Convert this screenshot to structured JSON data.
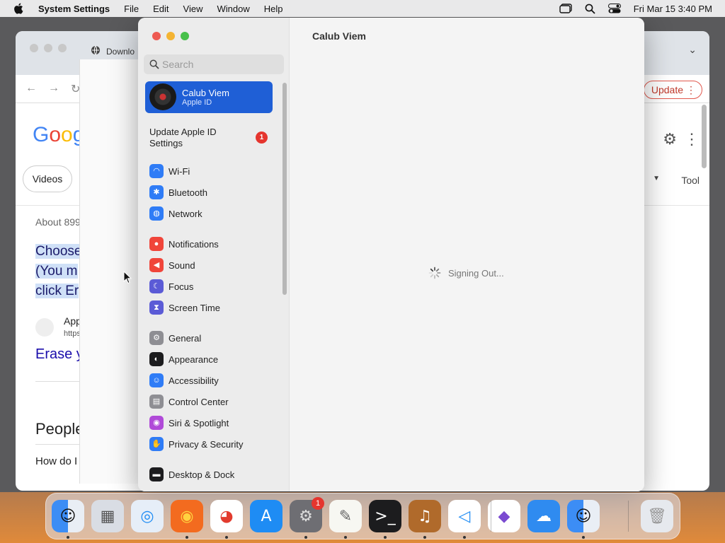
{
  "menubar": {
    "app_name": "System Settings",
    "items": [
      "File",
      "Edit",
      "View",
      "Window",
      "Help"
    ],
    "clock": "Fri Mar 15  3:40 PM"
  },
  "browser": {
    "tab_title": "Downlo",
    "update_label": "Update",
    "google_partial": "Goog",
    "videos_label": "Videos",
    "tools_partial": "Tool",
    "about_partial": "About 899",
    "choose_lines": [
      "Choose",
      "(You m",
      "click Er"
    ],
    "result_title_partial": "App",
    "result_url_partial": "https",
    "erase_partial": "Erase y",
    "people_partial": "People",
    "howdo_partial": "How do I"
  },
  "settings": {
    "search_placeholder": "Search",
    "account": {
      "name": "Calub Viem",
      "sub": "Apple ID"
    },
    "update_apple_id": "Update Apple ID Settings",
    "update_badge": "1",
    "sidebar_items": [
      {
        "label": "Wi-Fi",
        "color": "#2f7cf6"
      },
      {
        "label": "Bluetooth",
        "color": "#2f7cf6"
      },
      {
        "label": "Network",
        "color": "#2f7cf6"
      },
      {
        "label": "Notifications",
        "color": "#f0453a"
      },
      {
        "label": "Sound",
        "color": "#f0453a"
      },
      {
        "label": "Focus",
        "color": "#5b5bd6"
      },
      {
        "label": "Screen Time",
        "color": "#5b5bd6"
      },
      {
        "label": "General",
        "color": "#8e8e93"
      },
      {
        "label": "Appearance",
        "color": "#1c1c1e"
      },
      {
        "label": "Accessibility",
        "color": "#2f7cf6"
      },
      {
        "label": "Control Center",
        "color": "#8e8e93"
      },
      {
        "label": "Siri & Spotlight",
        "color": "#b04ad8"
      },
      {
        "label": "Privacy & Security",
        "color": "#2f7cf6"
      },
      {
        "label": "Desktop & Dock",
        "color": "#1c1c1e"
      }
    ],
    "content_title": "Calub Viem",
    "status_text": "Signing Out..."
  },
  "dock": {
    "settings_badge": "1",
    "apps": [
      "finder",
      "launchpad",
      "safari",
      "firefox",
      "chrome",
      "app-store",
      "system-settings",
      "textedit",
      "terminal",
      "garageband",
      "vscode",
      "visual-studio",
      "icloud-weather",
      "finder-2",
      "trash"
    ]
  }
}
